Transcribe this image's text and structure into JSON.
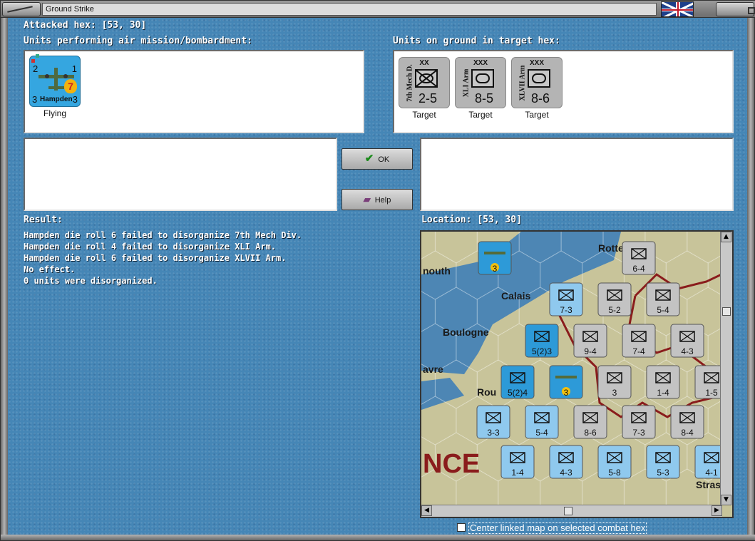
{
  "window": {
    "title": "Ground Strike"
  },
  "attacked_hex": {
    "label": "Attacked hex:",
    "value": "[53, 30]"
  },
  "air_panel": {
    "label": "Units performing air mission/bombardment:",
    "units": [
      {
        "name": "Hampden",
        "left_value": "2",
        "top_right": "1",
        "bottom_left": "3",
        "bottom_right": "3",
        "badge": "7",
        "status": "Flying"
      }
    ]
  },
  "ground_panel": {
    "label": "Units on ground in target hex:",
    "units": [
      {
        "name": "7th Mech D.",
        "size": "XX",
        "strength": "2-5",
        "status": "Target"
      },
      {
        "name": "XLI Arm",
        "size": "XXX",
        "strength": "8-5",
        "status": "Target"
      },
      {
        "name": "XLVII Arm",
        "size": "XXX",
        "strength": "8-6",
        "status": "Target"
      }
    ]
  },
  "buttons": {
    "ok": "OK",
    "help": "Help"
  },
  "result": {
    "label": "Result:",
    "lines": [
      "Hampden die roll 6 failed to disorganize 7th Mech Div.",
      "Hampden die roll 4 failed to disorganize XLI Arm.",
      "Hampden die roll 6 failed to disorganize XLVII Arm.",
      "No effect.",
      "0 units were disorganized."
    ]
  },
  "location": {
    "label": "Location:",
    "value": "[53, 30]"
  },
  "map": {
    "place_labels": [
      "Rotterd",
      "nouth",
      "Calais",
      "Boulogne",
      "avre",
      "Rou",
      "NCE",
      "Stras"
    ],
    "counters": [
      {
        "name": "Spitfire",
        "strength": "3",
        "side": "allied"
      },
      {
        "name": "",
        "strength": "6-4",
        "side": "axis"
      },
      {
        "name": "",
        "strength": "7-3",
        "side": "allied"
      },
      {
        "name": "",
        "strength": "5-2",
        "side": "axis"
      },
      {
        "name": "",
        "strength": "5-4",
        "side": "axis"
      },
      {
        "name": "",
        "strength": "5(2)3",
        "side": "allied"
      },
      {
        "name": "",
        "strength": "9-4",
        "side": "axis"
      },
      {
        "name": "",
        "strength": "7-4",
        "side": "axis"
      },
      {
        "name": "",
        "strength": "4-3",
        "side": "axis"
      },
      {
        "name": "",
        "strength": "5(2)4",
        "side": "allied"
      },
      {
        "name": "Spitfire",
        "strength": "3",
        "side": "allied"
      },
      {
        "name": "",
        "strength": "3",
        "side": "axis"
      },
      {
        "name": "",
        "strength": "1-4",
        "side": "axis"
      },
      {
        "name": "",
        "strength": "1-5",
        "side": "axis"
      },
      {
        "name": "",
        "strength": "3-3",
        "side": "allied"
      },
      {
        "name": "",
        "strength": "5-4",
        "side": "allied"
      },
      {
        "name": "",
        "strength": "8-6",
        "side": "axis"
      },
      {
        "name": "",
        "strength": "7-3",
        "side": "axis"
      },
      {
        "name": "",
        "strength": "8-4",
        "side": "axis"
      },
      {
        "name": "",
        "strength": "1-4",
        "side": "allied"
      },
      {
        "name": "",
        "strength": "4-3",
        "side": "allied"
      },
      {
        "name": "",
        "strength": "5-8",
        "side": "allied"
      },
      {
        "name": "",
        "strength": "5-3",
        "side": "allied"
      },
      {
        "name": "",
        "strength": "4-1",
        "side": "allied"
      }
    ]
  },
  "checkbox": {
    "label": "Center linked map on selected combat hex",
    "checked": false
  },
  "colors": {
    "allied": "#8fc9ee",
    "allied_dark": "#2d9ad8",
    "axis": "#c3c3c3",
    "sea": "#4d86b4",
    "land": "#c8c49a"
  }
}
